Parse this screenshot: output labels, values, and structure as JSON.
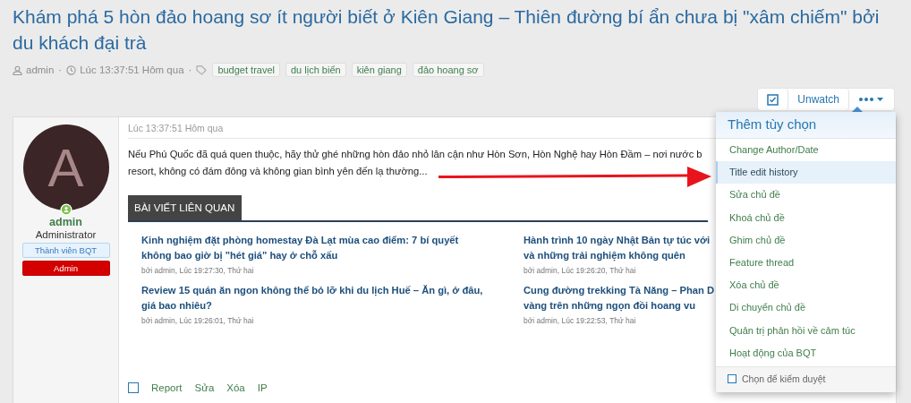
{
  "thread": {
    "title": "Khám phá 5 hòn đảo hoang sơ ít người biết ở Kiên Giang – Thiên đường bí ẩn chưa bị \"xâm chiếm\" bởi du khách đại trà",
    "author": "admin",
    "time": "Lúc 13:37:51 Hôm qua",
    "separator": "·",
    "tags": [
      "budget travel",
      "du lịch biển",
      "kiên giang",
      "đảo hoang sơ"
    ]
  },
  "toolbar": {
    "watch_label": "Unwatch"
  },
  "post": {
    "user": {
      "initial": "A",
      "name": "admin",
      "title": "Administrator",
      "online": true,
      "banners": [
        {
          "text": "Thành viên BQT",
          "kind": "staff"
        },
        {
          "text": "Admin",
          "kind": "admin"
        }
      ]
    },
    "time": "Lúc 13:37:51 Hôm qua",
    "body_lines": [
      "Nếu Phú Quốc đã quá quen thuộc, hãy thử ghé những hòn đảo nhỏ lân cận như Hòn Sơn, Hòn Nghệ hay Hòn Đầm – nơi nước b",
      "resort, không có đám đông và không gian bình yên đến lạ thường..."
    ],
    "related": {
      "tab": "BÀI VIẾT LIÊN QUAN",
      "items": [
        {
          "title_lines": [
            "Kinh nghiệm đặt phòng homestay Đà Lạt mùa cao điểm: 7 bí quyết",
            "không bao giờ bị \"hét giá\" hay ở chỗ xấu"
          ],
          "meta": "bởi admin, Lúc 19:27:30, Thứ hai"
        },
        {
          "title_lines": [
            "Hành trình 10 ngày Nhật Bản tự túc với",
            "và những trải nghiệm không quên"
          ],
          "meta": "bởi admin, Lúc 19:26:20, Thứ hai"
        },
        {
          "title_lines": [
            "Review 15 quán ăn ngon không thể bỏ lỡ khi du lịch Huế – Ăn gì, ở đâu,",
            "giá bao nhiêu?"
          ],
          "meta": "bởi admin, Lúc 19:26:01, Thứ hai"
        },
        {
          "title_lines": [
            "Cung đường trekking Tà Năng – Phan D",
            "vàng trên những ngọn đồi hoang vu"
          ],
          "meta": "bởi admin, Lúc 19:22:53, Thứ hai"
        }
      ]
    },
    "select_checked": false,
    "actions": [
      "Report",
      "Sửa",
      "Xóa",
      "IP"
    ]
  },
  "menu": {
    "title": "Thêm tùy chọn",
    "items": [
      {
        "label": "Change Author/Date",
        "selected": false
      },
      {
        "label": "Title edit history",
        "selected": true
      },
      {
        "label": "Sửa chủ đề",
        "selected": false
      },
      {
        "label": "Khoá chủ đề",
        "selected": false
      },
      {
        "label": "Ghim chủ đề",
        "selected": false
      },
      {
        "label": "Feature thread",
        "selected": false
      },
      {
        "label": "Xóa chủ đề",
        "selected": false
      },
      {
        "label": "Di chuyển chủ đề",
        "selected": false
      },
      {
        "label": "Quản trị phản hồi về cảm túc",
        "selected": false
      },
      {
        "label": "Hoạt động của BQT",
        "selected": false
      }
    ],
    "footer": {
      "label": "Chọn để kiểm duyệt",
      "checked": false
    }
  }
}
